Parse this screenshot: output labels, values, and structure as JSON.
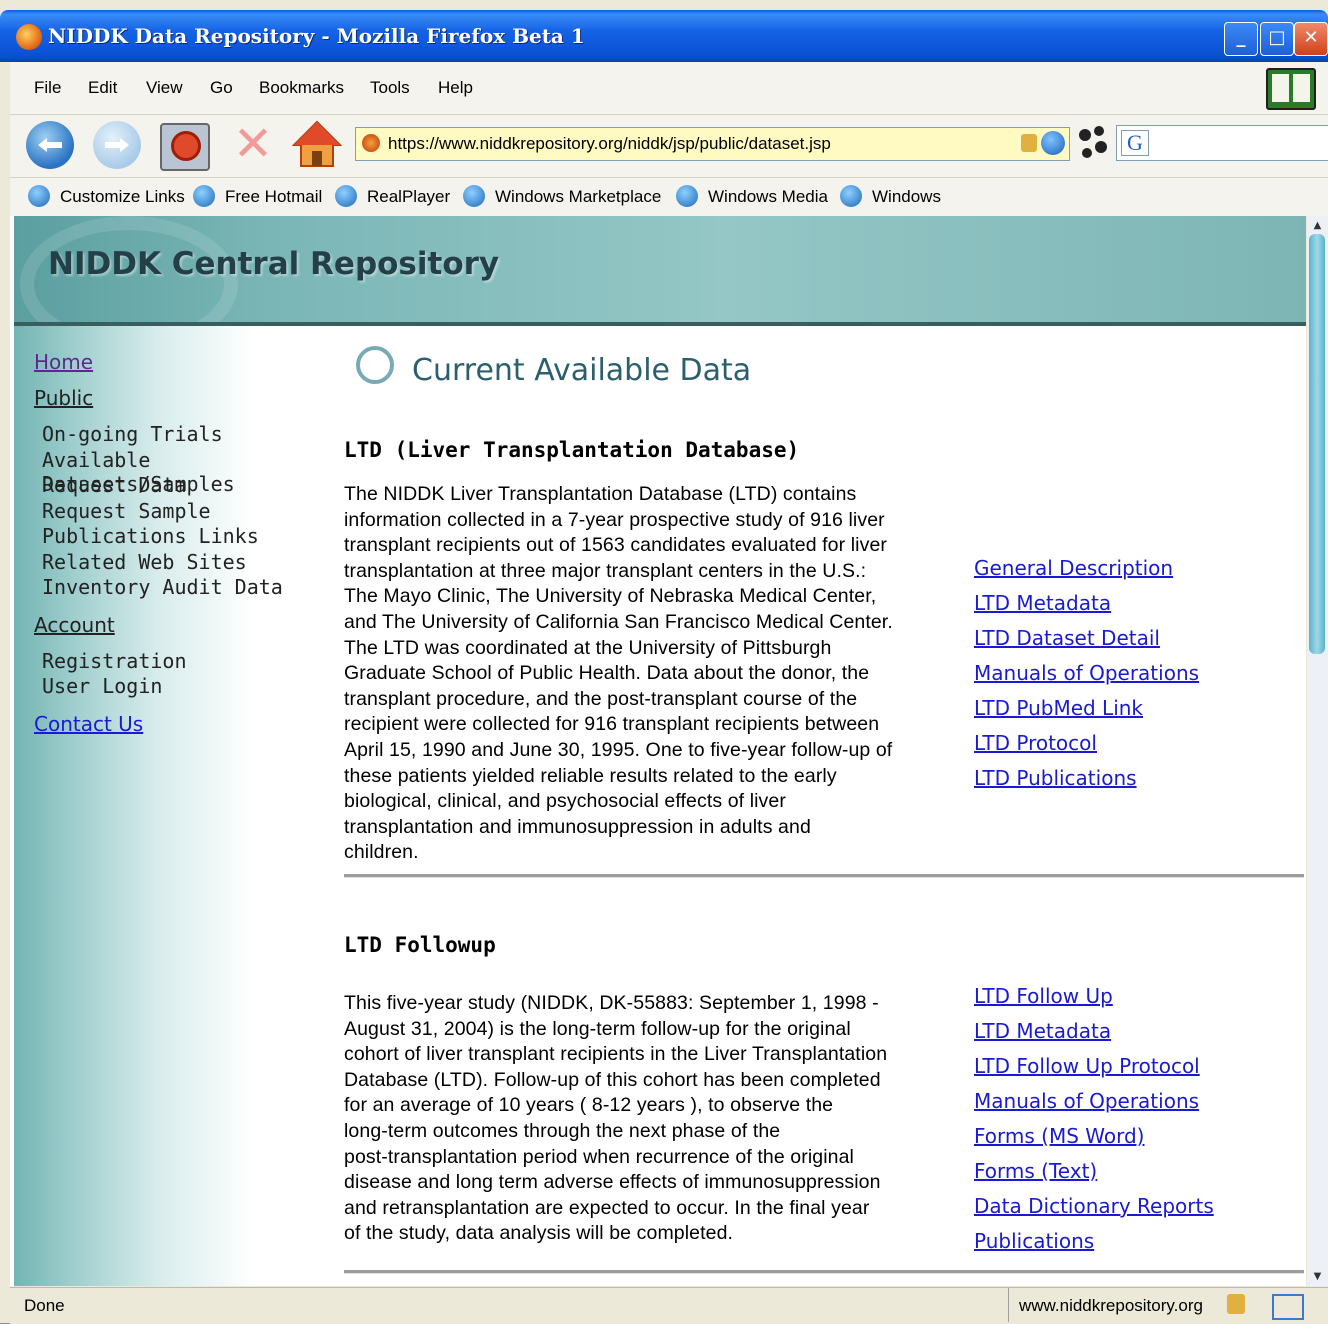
{
  "window": {
    "title": "NIDDK Data Repository - Mozilla Firefox Beta 1",
    "controls": [
      "minimize",
      "maximize",
      "close"
    ]
  },
  "menu": {
    "items": [
      "File",
      "Edit",
      "View",
      "Go",
      "Bookmarks",
      "Tools",
      "Help"
    ]
  },
  "nav": {
    "url": "https://www.niddkrepository.org/niddk/jsp/public/dataset.jsp",
    "search_value": ""
  },
  "links_toolbar": [
    "Customize Links",
    "Free Hotmail",
    "RealPlayer",
    "Windows Marketplace",
    "Windows Media",
    "Windows"
  ],
  "banner": {
    "title": "NIDDK Central Repository"
  },
  "sidebar": {
    "home": "Home",
    "public": "Public",
    "public_items": [
      "On-going Trials",
      "Available Datasets/Samples",
      "Request Data",
      "Request Sample",
      "Publications Links",
      "Related Web Sites",
      "Inventory Audit Data"
    ],
    "account": "Account",
    "account_items": [
      "Registration",
      "User Login"
    ],
    "contact": "Contact Us"
  },
  "main": {
    "page_title": "Current Available Data",
    "sections": [
      {
        "heading": "LTD (Liver Transplantation Database)",
        "lines": [
          "The NIDDK Liver Transplantation Database (LTD) contains",
          "information collected in a 7-year prospective study of 916 liver",
          "transplant recipients out of 1563 candidates evaluated for liver",
          "transplantation at three major transplant centers in the U.S.:",
          "The Mayo Clinic, The University of Nebraska Medical Center,",
          "and The University of California San Francisco Medical Center.",
          "The LTD was coordinated at the University of Pittsburgh",
          "Graduate School of Public Health. Data about the donor, the",
          "transplant procedure, and the post-transplant course of the",
          "recipient were collected for 916 transplant recipients between",
          "April 15, 1990 and June 30, 1995. One to five-year follow-up of",
          "these patients yielded reliable results related to the early",
          "biological, clinical, and psychosocial effects of liver",
          "transplantation and immunosuppression in adults and",
          "children."
        ],
        "links": [
          "General Description",
          "LTD Metadata",
          "LTD Dataset Detail",
          "Manuals of Operations",
          "LTD PubMed Link",
          "LTD Protocol",
          "LTD Publications"
        ]
      },
      {
        "heading": "LTD Followup",
        "lines": [
          "This five-year study (NIDDK, DK-55883: September 1, 1998 -",
          "August 31, 2004) is the long-term follow-up for the original",
          "cohort of liver transplant recipients in the Liver Transplantation",
          "Database (LTD). Follow-up of this cohort has been completed",
          "for an average of 10 years ( 8-12 years ), to observe the",
          "long-term outcomes through the next phase of the",
          "post-transplantation period when recurrence of the original",
          "disease and long term adverse effects of immunosuppression",
          "and retransplantation are expected to occur. In the final year",
          "of the study, data analysis will be completed."
        ],
        "links": [
          "LTD Follow Up",
          "LTD Metadata",
          "LTD Follow Up Protocol",
          "Manuals of Operations",
          "Forms (MS Word)",
          "Forms (Text)",
          "Data Dictionary Reports",
          "Publications"
        ]
      }
    ]
  },
  "status": {
    "text": "Done",
    "host": "www.niddkrepository.org"
  },
  "colors": {
    "titlebar": "#1563e6",
    "banner": "#7bb6b6",
    "link": "#1a1ad0",
    "visited_link": "#5b2a8c"
  }
}
